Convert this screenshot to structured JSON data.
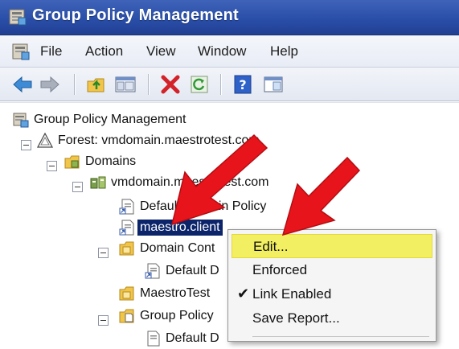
{
  "window": {
    "title": "Group Policy Management"
  },
  "menubar": {
    "items": [
      "File",
      "Action",
      "View",
      "Window",
      "Help"
    ]
  },
  "toolbar": {
    "buttons": [
      "back-icon",
      "forward-icon",
      "up-folder-icon",
      "show-hide-tree-icon",
      "delete-icon",
      "refresh-icon",
      "help-icon",
      "properties-icon"
    ]
  },
  "tree": {
    "items": [
      {
        "label": "Group Policy Management",
        "icon": "gpm-console-icon"
      },
      {
        "label": "Forest: vmdomain.maestrotest.com",
        "icon": "forest-icon"
      },
      {
        "label": "Domains",
        "icon": "domains-folder-icon"
      },
      {
        "label": "vmdomain.maestrotest.com",
        "icon": "domain-icon"
      },
      {
        "label": "Default Domain Policy",
        "icon": "gpo-link-icon"
      },
      {
        "label": "maestro.client",
        "icon": "gpo-link-icon",
        "selected": true
      },
      {
        "label": "Domain Cont",
        "icon": "ou-folder-icon"
      },
      {
        "label": "Default D",
        "icon": "gpo-link-icon"
      },
      {
        "label": "MaestroTest",
        "icon": "ou-folder-icon"
      },
      {
        "label": "Group Policy",
        "icon": "gpo-folder-icon"
      },
      {
        "label": "Default D",
        "icon": "gpo-icon"
      }
    ]
  },
  "context_menu": {
    "items": [
      {
        "label": "Edit...",
        "highlighted": true,
        "checked": false
      },
      {
        "label": "Enforced",
        "highlighted": false,
        "checked": false
      },
      {
        "label": "Link Enabled",
        "highlighted": false,
        "checked": true
      },
      {
        "label": "Save Report...",
        "highlighted": false,
        "checked": false
      }
    ],
    "check_glyph": "✔"
  },
  "colors": {
    "titlebar": "#2a4fa9",
    "selection": "#0b246a",
    "menu_highlight": "#f3ef62",
    "annotation_arrow": "#e8141b"
  }
}
